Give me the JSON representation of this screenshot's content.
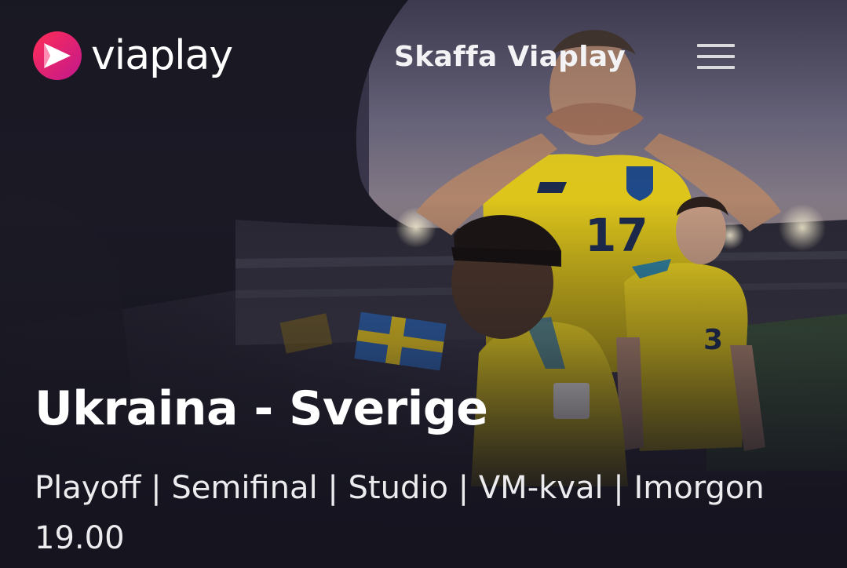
{
  "header": {
    "logo_text": "viaplay",
    "cta_label": "Skaffa Viaplay",
    "menu_icon": "hamburger-menu-icon"
  },
  "hero": {
    "title": "Ukraina - Sverige",
    "meta": "Playoff | Semifinal | Studio | VM-kval | Imorgon 19.00"
  },
  "colors": {
    "brand_gradient_start": "#ff2d55",
    "brand_gradient_end": "#c2188e",
    "jersey_yellow": "#f2d421",
    "background": "#15141f"
  }
}
